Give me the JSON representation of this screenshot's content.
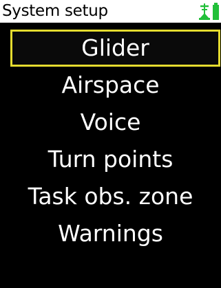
{
  "header": {
    "title": "System setup",
    "status_icon": "gps-antenna-icon",
    "status_color": "#22c03a"
  },
  "menu": {
    "selected_index": 0,
    "highlight_color": "#e5dc2f",
    "items": [
      {
        "label": "Glider"
      },
      {
        "label": "Airspace"
      },
      {
        "label": "Voice"
      },
      {
        "label": "Turn points"
      },
      {
        "label": "Task obs. zone"
      },
      {
        "label": "Warnings"
      }
    ]
  }
}
